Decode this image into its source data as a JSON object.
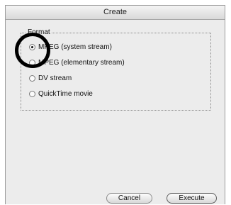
{
  "window": {
    "title": "Create"
  },
  "format_group": {
    "label": "Format",
    "options": [
      {
        "label": "MPEG (system stream)",
        "checked": true
      },
      {
        "label": "MPEG (elementary stream)",
        "checked": false
      },
      {
        "label": "DV stream",
        "checked": false
      },
      {
        "label": "QuickTime movie",
        "checked": false
      }
    ]
  },
  "buttons": {
    "cancel": "Cancel",
    "execute": "Execute"
  }
}
